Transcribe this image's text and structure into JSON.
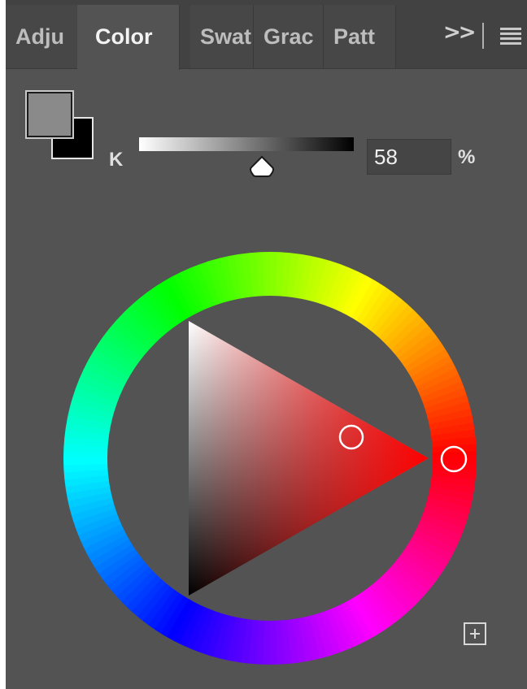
{
  "tabs": [
    {
      "label": "Adju",
      "active": false
    },
    {
      "label": "Color",
      "active": true
    },
    {
      "label": "Swat",
      "active": false
    },
    {
      "label": "Grac",
      "active": false
    },
    {
      "label": "Patt",
      "active": false
    }
  ],
  "header": {
    "more_label": ">>",
    "menu_icon": "hamburger-menu-icon"
  },
  "swatches": {
    "foreground_color": "#8a8a8a",
    "background_color": "#000000"
  },
  "k_slider": {
    "channel_label": "K",
    "value": "58",
    "unit": "%"
  },
  "color_wheel": {
    "hue_marker_color": "#ff0000",
    "triangle_marker_color": "#d65c5c"
  },
  "footer": {
    "add_icon": "plus-square-icon"
  }
}
